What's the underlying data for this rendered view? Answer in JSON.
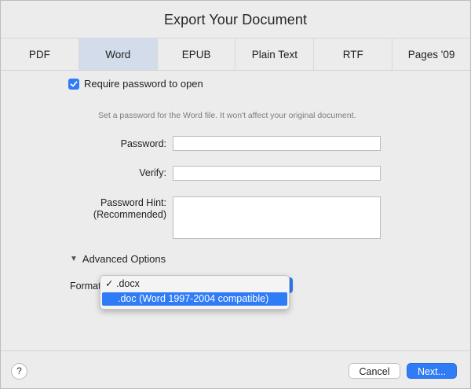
{
  "window": {
    "title": "Export Your Document"
  },
  "tabs": [
    {
      "label": "PDF",
      "active": false
    },
    {
      "label": "Word",
      "active": true
    },
    {
      "label": "EPUB",
      "active": false
    },
    {
      "label": "Plain Text",
      "active": false
    },
    {
      "label": "RTF",
      "active": false
    },
    {
      "label": "Pages '09",
      "active": false
    }
  ],
  "word": {
    "require_password": {
      "label": "Require password to open",
      "checked": true
    },
    "hint_text": "Set a password for the Word file. It won't affect your original document.",
    "password_label": "Password:",
    "verify_label": "Verify:",
    "hint_label_line1": "Password Hint:",
    "hint_label_line2": "(Recommended)",
    "password_value": "",
    "verify_value": "",
    "hint_value": ""
  },
  "advanced": {
    "toggle_label": "Advanced Options",
    "expanded": true,
    "format_label": "Format",
    "format_menu": [
      {
        "label": ".docx",
        "checked": true,
        "highlighted": false
      },
      {
        "label": ".doc (Word 1997-2004 compatible)",
        "checked": false,
        "highlighted": true
      }
    ]
  },
  "footer": {
    "help_label": "?",
    "cancel_label": "Cancel",
    "next_label": "Next..."
  },
  "colors": {
    "accent": "#2f7cf6",
    "active_tab": "#d3dceb",
    "background": "#ececec"
  }
}
